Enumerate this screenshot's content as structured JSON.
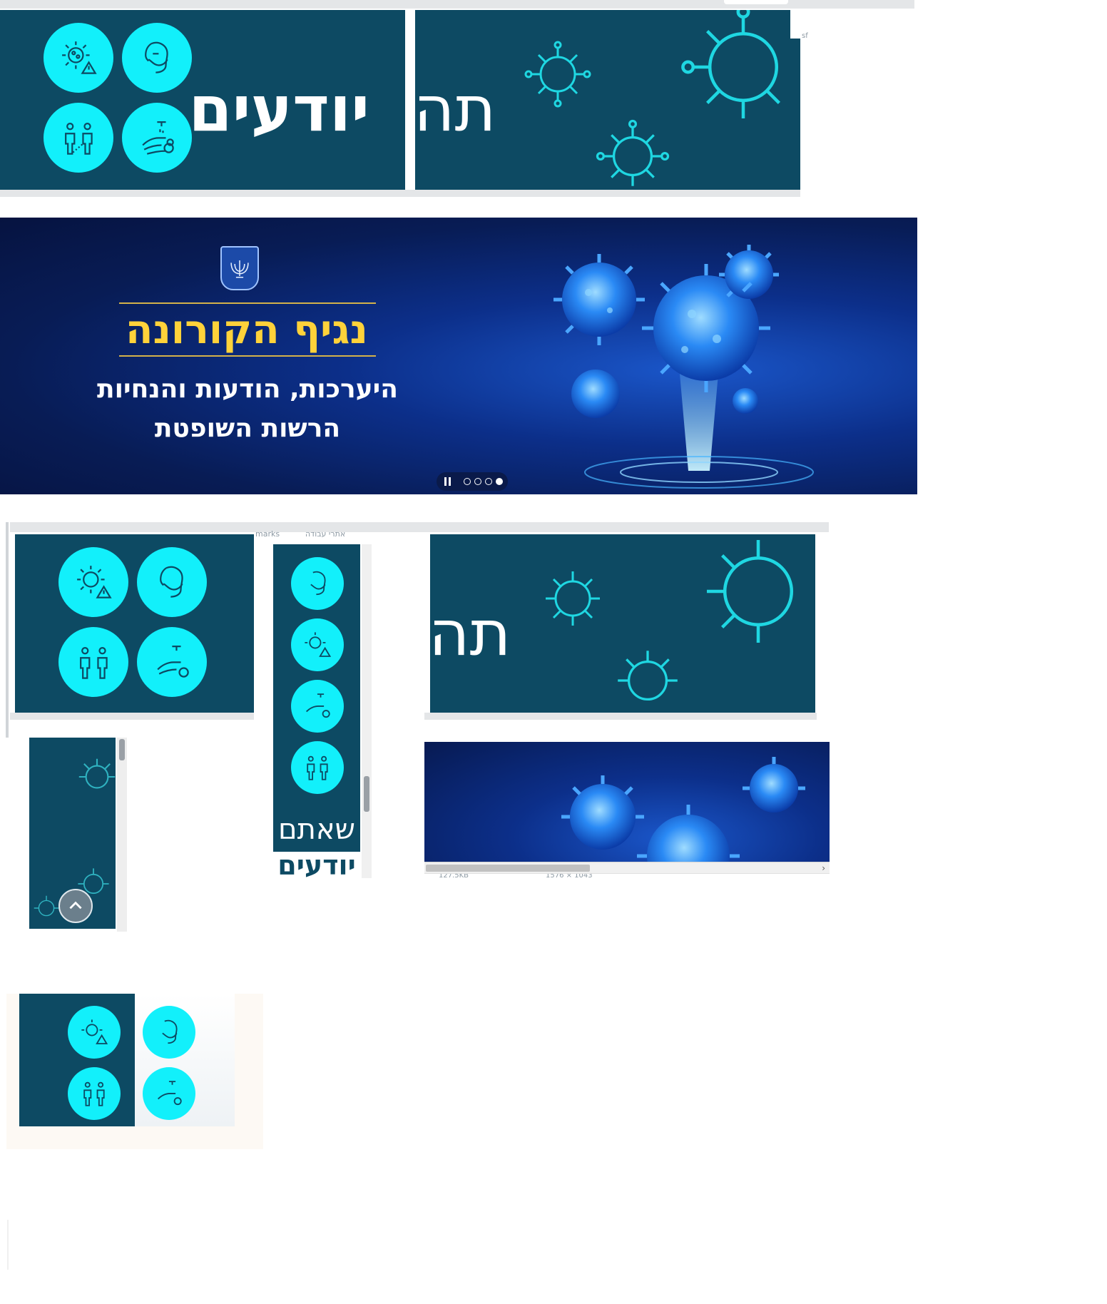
{
  "panel1": {
    "heading_line1": "יודעים",
    "heading_fragment": "תה"
  },
  "banner": {
    "title": "נגיף הקורונה",
    "subtitle_line1": "היערכות, הודעות והנחיות",
    "subtitle_line2": "הרשות השופטת",
    "slide_count": 4,
    "active_slide": 1
  },
  "panel_vertical": {
    "text_line1": "שאתם",
    "text_line2": "יודעים"
  },
  "panel_topright": {
    "heading_fragment": "תה"
  },
  "browser_fragments": {
    "bookmarks_text": "marks",
    "bookmark_label": "אתרי עבודה",
    "status_size": "127.5KB",
    "status_dims": "1576 × 1043"
  },
  "colors": {
    "teal": "#0d4a63",
    "cyan": "#12f0fb",
    "banner_blue": "#0c2f8a",
    "yellow": "#ffd23a"
  },
  "icons": [
    "virus-warning-icon",
    "face-mask-icon",
    "social-distance-icon",
    "hand-wash-icon",
    "virus-outline-icon",
    "emblem-icon",
    "chevron-up-icon",
    "pause-icon"
  ]
}
